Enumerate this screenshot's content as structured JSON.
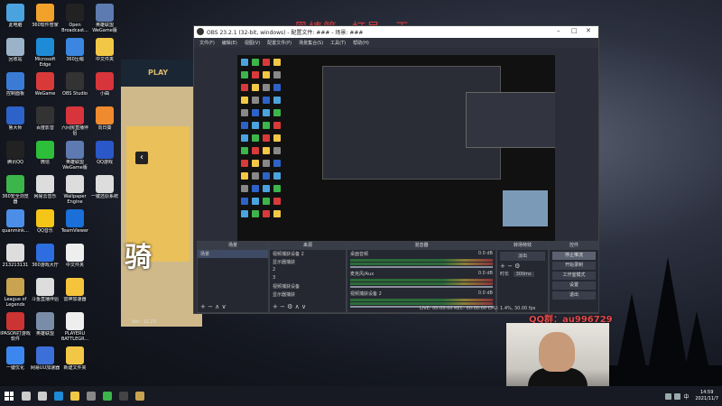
{
  "desktop": {
    "icons": [
      {
        "label": "此电脑",
        "color": "#4aa3df"
      },
      {
        "label": "回收站",
        "color": "#9bb3c9"
      },
      {
        "label": "控制面板",
        "color": "#3a7bd5"
      },
      {
        "label": "鲁大师",
        "color": "#2d63c8"
      },
      {
        "label": "腾讯QQ",
        "color": "#222"
      },
      {
        "label": "360安全浏览器",
        "color": "#3cb54a"
      },
      {
        "label": "quanmink...",
        "color": "#4b8ee8"
      },
      {
        "label": "213213131",
        "color": "#ddd"
      },
      {
        "label": "League of Legends",
        "color": "#c8a350"
      },
      {
        "label": "IPASON打游戏软件",
        "color": "#c33"
      },
      {
        "label": "一键优化",
        "color": "#3c87ef"
      },
      {
        "label": "360软件管家",
        "color": "#f1a22a"
      },
      {
        "label": "Microsoft Edge",
        "color": "#1e8bd6"
      },
      {
        "label": "WeGame",
        "color": "#d83a3a"
      },
      {
        "label": "百度影音",
        "color": "#333"
      },
      {
        "label": "微信",
        "color": "#2dbf3a"
      },
      {
        "label": "网易云音乐",
        "color": "#ddd"
      },
      {
        "label": "QQ音乐",
        "color": "#f5c518"
      },
      {
        "label": "360游戏大厅",
        "color": "#2d6de0"
      },
      {
        "label": "斗鱼直播伴侣",
        "color": "#ddd"
      },
      {
        "label": "英雄联盟",
        "color": "#7a8da8"
      },
      {
        "label": "网易UU加速器",
        "color": "#3c6fd8"
      },
      {
        "label": "Open Broadcast...",
        "color": "#222"
      },
      {
        "label": "360压缩",
        "color": "#3a86e0"
      },
      {
        "label": "OBS Studio",
        "color": "#333"
      },
      {
        "label": "六间房直播伴侣",
        "color": "#d8343b"
      },
      {
        "label": "英雄联盟WeGame版",
        "color": "#5d7bb0"
      },
      {
        "label": "Wallpaper Engine",
        "color": "#ddd"
      },
      {
        "label": "TeamViewer",
        "color": "#1a6fd8"
      },
      {
        "label": "中文件夹",
        "color": "#eee"
      },
      {
        "label": "雷神加速器",
        "color": "#f5c43a"
      },
      {
        "label": "PLAYERU BATTLEGR...",
        "color": "#eee"
      },
      {
        "label": "新建文件夹",
        "color": "#f3c746"
      },
      {
        "label": "英雄联盟WeGame版",
        "color": "#5d7bb0"
      },
      {
        "label": "中文件夹",
        "color": "#f3c746"
      },
      {
        "label": "小曲",
        "color": "#d8343b"
      },
      {
        "label": "向日葵",
        "color": "#f08a2e"
      },
      {
        "label": "QQ游戏",
        "color": "#2a58c8"
      },
      {
        "label": "一键还原系统",
        "color": "#ddd"
      }
    ]
  },
  "overlay_title": "黑椿第一打号一天",
  "obs": {
    "window_title": "OBS 23.2.1 (32-bit, windows) - 配置文件: ### - 场景: ###",
    "menu": [
      "文件(F)",
      "编辑(E)",
      "视图(V)",
      "配置文件(P)",
      "场景集合(S)",
      "工具(T)",
      "帮助(H)"
    ],
    "docks": {
      "scenes": {
        "title": "场景",
        "items": [
          "场景"
        ]
      },
      "sources": {
        "title": "来源",
        "items": [
          "视频捕获设备 2",
          "显示器捕获",
          "2",
          "3",
          "视频捕获设备",
          "显示器捕获"
        ]
      },
      "mixer": {
        "title": "混音器",
        "channels": [
          {
            "name": "桌面音频",
            "value": "0.0 dB"
          },
          {
            "name": "麦克风/Aux",
            "value": "0.0 dB"
          },
          {
            "name": "视频捕获设备 2",
            "value": "0.0 dB"
          }
        ]
      },
      "transitions": {
        "title": "转场特效",
        "type": "淡出",
        "duration_label": "时长",
        "duration": "300ms"
      },
      "controls": {
        "title": "控件",
        "buttons": [
          "停止推流",
          "开始录制",
          "工作室模式",
          "设置",
          "退出"
        ]
      }
    },
    "status": "LIVE: 00:00:00    REC: 00:00:00    CPU: 1.4%, 30.00 fps"
  },
  "game": {
    "play_label": "PLAY",
    "footer": "Ver.: 11.23"
  },
  "webcam": {
    "overlay_text": "QQ群：au996729"
  },
  "taskbar": {
    "icons": [
      {
        "name": "search-icon",
        "color": "#ccc"
      },
      {
        "name": "task-view-icon",
        "color": "#ccc"
      },
      {
        "name": "edge-icon",
        "color": "#1e8bd6"
      },
      {
        "name": "file-explorer-icon",
        "color": "#f3c746"
      },
      {
        "name": "store-icon",
        "color": "#888"
      },
      {
        "name": "360-icon",
        "color": "#3cb54a"
      },
      {
        "name": "obs-icon",
        "color": "#444"
      },
      {
        "name": "league-icon",
        "color": "#c8a350"
      }
    ],
    "time": "14:59",
    "date": "2021/11/7",
    "ime": "中"
  }
}
